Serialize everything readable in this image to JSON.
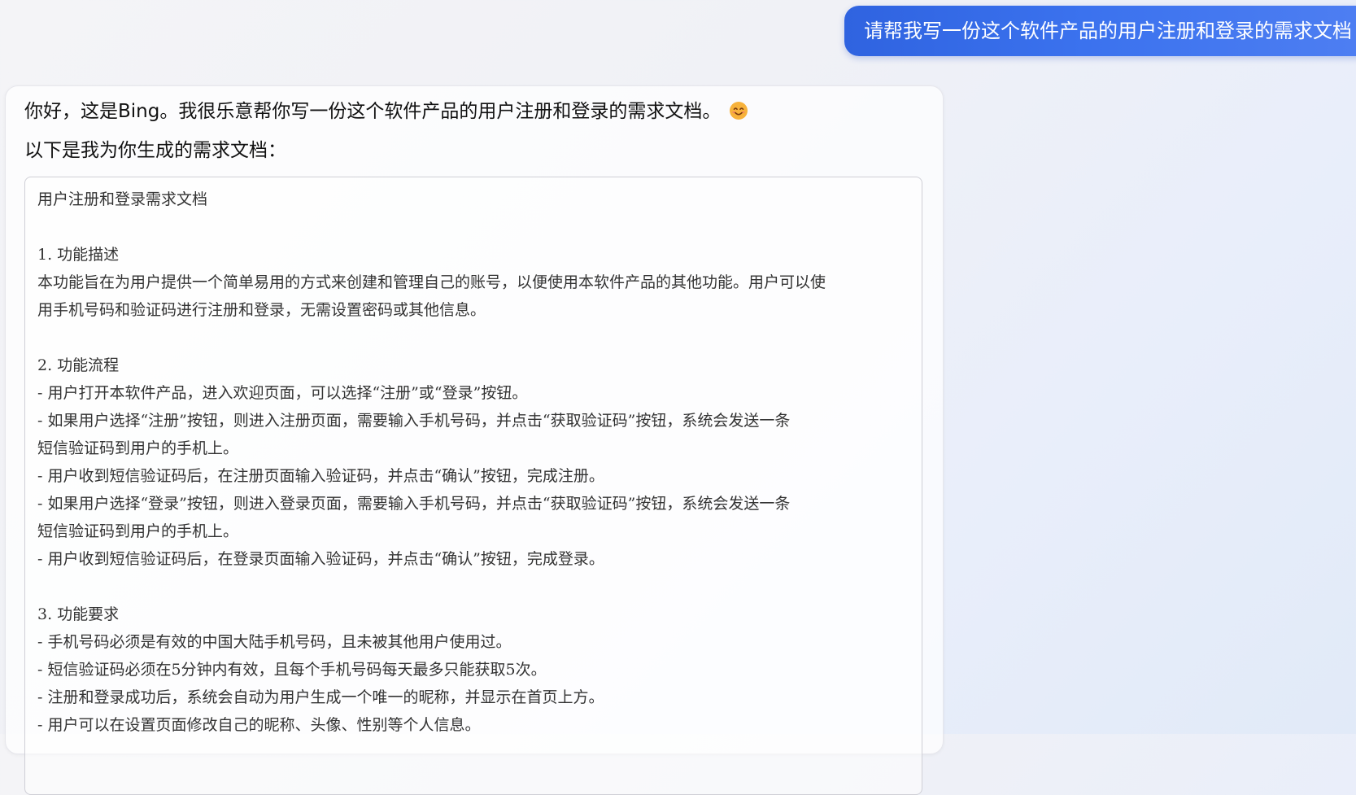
{
  "user_message": "请帮我写一份这个软件产品的用户注册和登录的需求文档",
  "response": {
    "greeting": "你好，这是Bing。我很乐意帮你写一份这个软件产品的用户注册和登录的需求文档。",
    "emoji": "smiley-face-icon",
    "intro": "以下是我为你生成的需求文档：",
    "document_lines": [
      "用户注册和登录需求文档",
      "",
      "1. 功能描述",
      "本功能旨在为用户提供一个简单易用的方式来创建和管理自己的账号，以便使用本软件产品的其他功能。用户可以使",
      "用手机号码和验证码进行注册和登录，无需设置密码或其他信息。",
      "",
      "2. 功能流程",
      "- 用户打开本软件产品，进入欢迎页面，可以选择“注册”或“登录”按钮。",
      "- 如果用户选择“注册”按钮，则进入注册页面，需要输入手机号码，并点击“获取验证码”按钮，系统会发送一条",
      "短信验证码到用户的手机上。",
      "- 用户收到短信验证码后，在注册页面输入验证码，并点击“确认”按钮，完成注册。",
      "- 如果用户选择“登录”按钮，则进入登录页面，需要输入手机号码，并点击“获取验证码”按钮，系统会发送一条",
      "短信验证码到用户的手机上。",
      "- 用户收到短信验证码后，在登录页面输入验证码，并点击“确认”按钮，完成登录。",
      "",
      "3. 功能要求",
      "- 手机号码必须是有效的中国大陆手机号码，且未被其他用户使用过。",
      "- 短信验证码必须在5分钟内有效，且每个手机号码每天最多只能获取5次。",
      "- 注册和登录成功后，系统会自动为用户生成一个唯一的昵称，并显示在首页上方。",
      "- 用户可以在设置页面修改自己的昵称、头像、性别等个人信息。"
    ]
  }
}
